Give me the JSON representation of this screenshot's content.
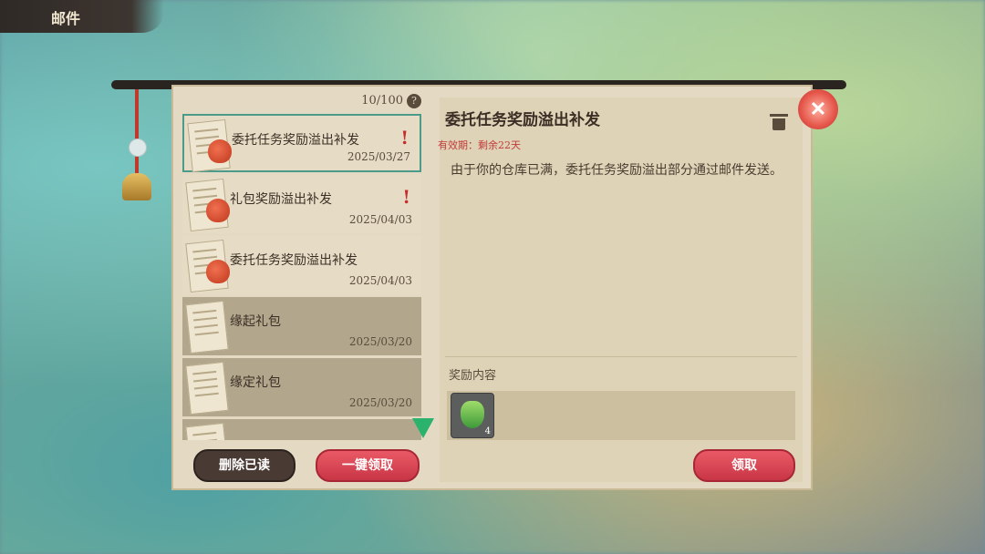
{
  "header": {
    "title": "邮件"
  },
  "mail_list": {
    "count": "10/100",
    "help_icon": "?",
    "items": [
      {
        "title": "委托任务奖励溢出补发",
        "date": "2025/03/27",
        "status": "unread",
        "alert": "!",
        "selected": true
      },
      {
        "title": "礼包奖励溢出补发",
        "date": "2025/04/03",
        "status": "unread",
        "alert": "!"
      },
      {
        "title": "委托任务奖励溢出补发",
        "date": "2025/04/03",
        "status": "unread"
      },
      {
        "title": "缘起礼包",
        "date": "2025/03/20",
        "status": "read"
      },
      {
        "title": "缘定礼包",
        "date": "2025/03/20",
        "status": "read"
      },
      {
        "title": "",
        "date": "",
        "status": "read"
      }
    ]
  },
  "buttons": {
    "delete_read": "删除已读",
    "claim_all": "一键领取",
    "claim": "领取"
  },
  "detail": {
    "title": "委托任务奖励溢出补发",
    "expire": "有效期：剩余22天",
    "body": "由于你的仓库已满，委托任务奖励溢出部分通过邮件发送。",
    "reward_label": "奖励内容",
    "rewards": [
      {
        "icon": "green-material-icon",
        "quantity": "4"
      }
    ]
  },
  "colors": {
    "accent_red": "#c93646",
    "selected_border": "#4c9a8a",
    "expire_text": "#c23a3a"
  }
}
